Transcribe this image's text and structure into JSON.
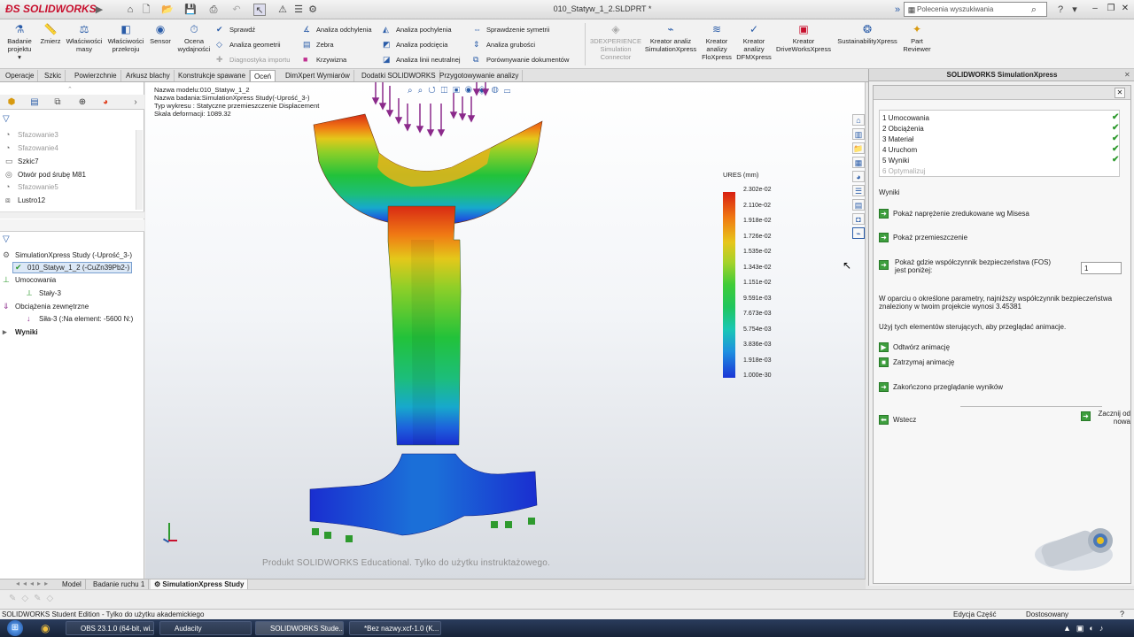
{
  "app": {
    "logo": "SOLIDWORKS",
    "doc_title": "010_Statyw_1_2.SLDPRT *",
    "search_placeholder": "Polecenia wyszukiwania"
  },
  "ribbon": {
    "big_buttons": [
      {
        "label": "Badanie projektu",
        "icon": "study-icon"
      },
      {
        "label": "Zmierz",
        "icon": "measure-icon"
      },
      {
        "label": "Właściwości masy",
        "icon": "mass-properties-icon"
      },
      {
        "label": "Właściwości przekroju",
        "icon": "section-properties-icon"
      },
      {
        "label": "Sensor",
        "icon": "sensor-icon"
      },
      {
        "label": "Ocena wydajności",
        "icon": "performance-icon"
      }
    ],
    "col1": [
      "Sprawdź",
      "Analiza geometrii",
      "Diagnostyka importu"
    ],
    "col2": [
      "Analiza odchylenia",
      "Zebra",
      "Krzywizna"
    ],
    "col3": [
      "Analiza pochylenia",
      "Analiza podcięcia",
      "Analiza linii neutralnej"
    ],
    "col4": [
      "Sprawdzenie symetrii",
      "Analiza grubości",
      "Porównywanie dokumentów"
    ],
    "right_buttons": [
      {
        "label": "3DEXPERIENCE Simulation Connector",
        "disabled": true
      },
      {
        "label": "Kreator analiz SimulationXpress",
        "disabled": false
      },
      {
        "label": "Kreator analizy FloXpress",
        "disabled": false
      },
      {
        "label": "Kreator analizy DFMXpress",
        "disabled": false
      },
      {
        "label": "Kreator DriveWorksXpress",
        "disabled": false
      },
      {
        "label": "SustainabilityXpress",
        "disabled": false
      },
      {
        "label": "Part Reviewer",
        "disabled": false
      }
    ]
  },
  "command_tabs": [
    "Operacje",
    "Szkic",
    "Powierzchnie",
    "Arkusz blachy",
    "Konstrukcje spawane",
    "Oceń",
    "DimXpert Wymiarów",
    "Dodatki SOLIDWORKS",
    "Przygotowywanie analizy"
  ],
  "command_tabs_active": "Oceń",
  "feature_tree": [
    {
      "label": "Sfazowanie3",
      "gray": true
    },
    {
      "label": "Sfazowanie4",
      "gray": true
    },
    {
      "label": "Szkic7",
      "gray": false
    },
    {
      "label": "Otwór pod śrubę M81",
      "gray": false
    },
    {
      "label": "Sfazowanie5",
      "gray": true
    },
    {
      "label": "Lustro12",
      "gray": false
    }
  ],
  "study_tree": {
    "root": "SimulationXpress Study (-Uprość_3-)",
    "part": "010_Statyw_1_2 (-CuZn39Pb2-)",
    "fixtures": "Umocowania",
    "fixture_item": "Stały-3",
    "loads": "Obciążenia zewnętrzne",
    "load_item": "Siła-3 (:Na element: -5600 N:)",
    "results": "Wyniki"
  },
  "viewport": {
    "info_lines": [
      "Nazwa modelu:010_Statyw_1_2",
      "Nazwa badania:SimulationXpress Study(-Uprość_3-)",
      "Typ wykresu : Statyczne przemieszczenie Displacement",
      "Skala deformacji: 1089.32"
    ],
    "watermark": "Produkt SOLIDWORKS Educational. Tylko do użytku instruktażowego.",
    "legend_title": "URES (mm)",
    "legend_labels": [
      "2.302e-02",
      "2.110e-02",
      "1.918e-02",
      "1.726e-02",
      "1.535e-02",
      "1.343e-02",
      "1.151e-02",
      "9.591e-03",
      "7.673e-03",
      "5.754e-03",
      "3.836e-03",
      "1.918e-03",
      "1.000e-30"
    ]
  },
  "simxpress": {
    "title": "SOLIDWORKS SimulationXpress",
    "steps": [
      {
        "label": "1  Umocowania",
        "done": true
      },
      {
        "label": "2  Obciążenia",
        "done": true
      },
      {
        "label": "3  Materiał",
        "done": true
      },
      {
        "label": "4  Uruchom",
        "done": true
      },
      {
        "label": "5  Wyniki",
        "done": true
      },
      {
        "label": "6  Optymalizuj",
        "done": false
      }
    ],
    "section": "Wyniki",
    "show_stress": "Pokaż naprężenie zredukowane wg Misesa",
    "show_displacement": "Pokaż przemieszczenie",
    "show_fos": "Pokaż gdzie współczynnik bezpieczeństwa (FOS) jest poniżej:",
    "fos_value": "1",
    "message": "W oparciu o określone parametry, najniższy współczynnik bezpieczeństwa znaleziony w twoim projekcie wynosi 3.45381",
    "hint": "Użyj tych elementów sterujących, aby przeglądać animacje.",
    "play": "Odtwórz animację",
    "stop": "Zatrzymaj animację",
    "done": "Zakończono przeglądanie wyników",
    "back": "Wstecz",
    "restart": "Zacznij od nowa"
  },
  "bottom_tabs": [
    "Model",
    "Badanie ruchu 1",
    "SimulationXpress Study"
  ],
  "status": {
    "left": "SOLIDWORKS Student Edition - Tylko do użytku akademickiego",
    "edit": "Edycja Część",
    "units": "Dostosowany"
  },
  "taskbar": [
    "OBS 23.1.0 (64-bit, wi...",
    "Audacity",
    "SOLIDWORKS Stude...",
    "*Bez nazwy.xcf-1.0 (K..."
  ],
  "colors": {
    "accent": "#2a5ca8",
    "check": "#2e9a2e",
    "logo": "#c8102e"
  }
}
